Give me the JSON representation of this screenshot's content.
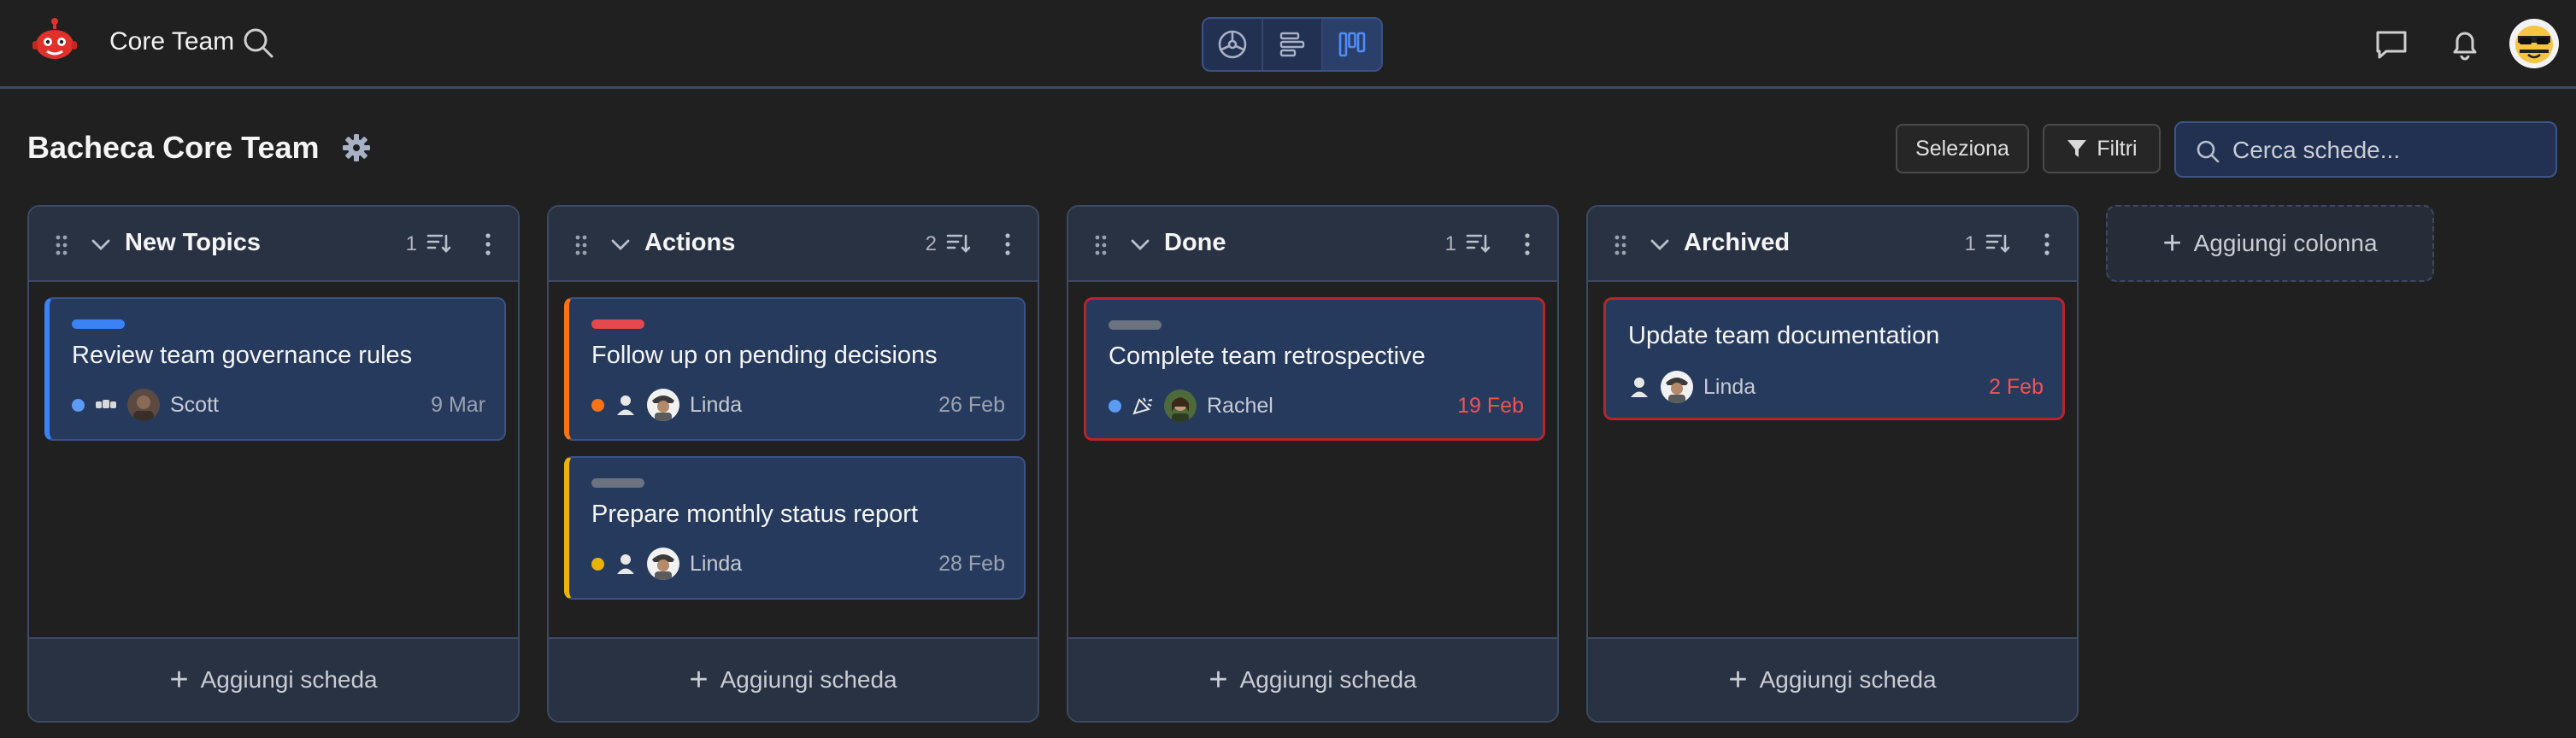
{
  "header": {
    "team_name": "Core Team",
    "icons": [
      "robot-logo-icon",
      "search-icon",
      "dashboard-icon",
      "list-view-icon",
      "kanban-icon",
      "chat-icon",
      "bell-icon",
      "avatar"
    ]
  },
  "board": {
    "title": "Bacheca Core Team",
    "select_label": "Seleziona",
    "filters_label": "Filtri",
    "search_placeholder": "Cerca schede...",
    "add_column_label": "Aggiungi colonna",
    "add_card_label": "Aggiungi scheda"
  },
  "colors": {
    "background": "#202020",
    "card": "#263a5e",
    "accent_blue": "#3b82f6",
    "accent_orange": "#f97316",
    "accent_yellow": "#eab308",
    "accent_red": "#e5484d",
    "accent_gray": "#6b7280",
    "overdue_text": "#f05353"
  },
  "columns": [
    {
      "title": "New Topics",
      "count": "1",
      "cards": [
        {
          "title": "Review team governance rules",
          "assignee": "Scott",
          "date": "9 Mar",
          "label_color": "#3b82f6",
          "dot_color": "#5b9bf5",
          "accent_color": "#3b82f6",
          "overdue": false
        }
      ]
    },
    {
      "title": "Actions",
      "count": "2",
      "cards": [
        {
          "title": "Follow up on pending decisions",
          "assignee": "Linda",
          "date": "26 Feb",
          "label_color": "#e5484d",
          "dot_color": "#f97316",
          "accent_color": "#f97316",
          "overdue": false
        },
        {
          "title": "Prepare monthly status report",
          "assignee": "Linda",
          "date": "28 Feb",
          "label_color": "#6b7280",
          "dot_color": "#eab308",
          "accent_color": "#eab308",
          "overdue": false
        }
      ]
    },
    {
      "title": "Done",
      "count": "1",
      "cards": [
        {
          "title": "Complete team retrospective",
          "assignee": "Rachel",
          "date": "19 Feb",
          "label_color": "#6b7280",
          "dot_color": "#5b9bf5",
          "accent_color": "#b4262c",
          "overdue": true
        }
      ]
    },
    {
      "title": "Archived",
      "count": "1",
      "cards": [
        {
          "title": "Update team documentation",
          "assignee": "Linda",
          "date": "2 Feb",
          "overdue": true
        }
      ]
    }
  ]
}
